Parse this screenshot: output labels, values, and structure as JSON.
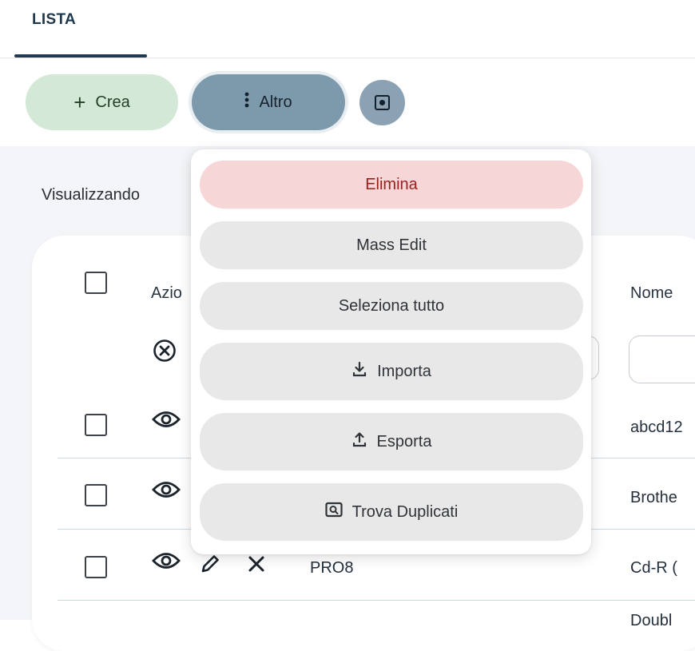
{
  "tabs": [
    {
      "label": "LISTA"
    }
  ],
  "toolbar": {
    "create_label": "Crea",
    "more_label": "Altro"
  },
  "status": {
    "prefix": "Visualizzando"
  },
  "table": {
    "header_actions_partial": "Azio",
    "header_name_partial": "Nome",
    "rows": [
      {
        "code": "",
        "name_partial": "abcd12"
      },
      {
        "code": "",
        "name_partial": "Brothe"
      },
      {
        "code": "PRO8",
        "name_partial": "Cd-R ("
      },
      {
        "code": "",
        "name_partial": "Doubl"
      }
    ]
  },
  "menu": {
    "items": [
      {
        "label": "Elimina",
        "variant": "danger",
        "icon": ""
      },
      {
        "label": "Mass Edit",
        "variant": "default",
        "icon": ""
      },
      {
        "label": "Seleziona tutto",
        "variant": "default",
        "icon": ""
      },
      {
        "label": "Importa",
        "variant": "default",
        "icon": "download-icon"
      },
      {
        "label": "Esporta",
        "variant": "default",
        "icon": "upload-icon"
      },
      {
        "label": "Trova Duplicati",
        "variant": "default",
        "icon": "find-duplicates-icon"
      }
    ]
  },
  "colors": {
    "tab_underline": "#1f3a52",
    "create_button": "#d3e8d6",
    "more_button": "#7d9aac",
    "danger_item_bg": "#f6d6d6",
    "danger_item_text": "#9a1f1f",
    "menu_item_bg": "#e8e8e8"
  }
}
